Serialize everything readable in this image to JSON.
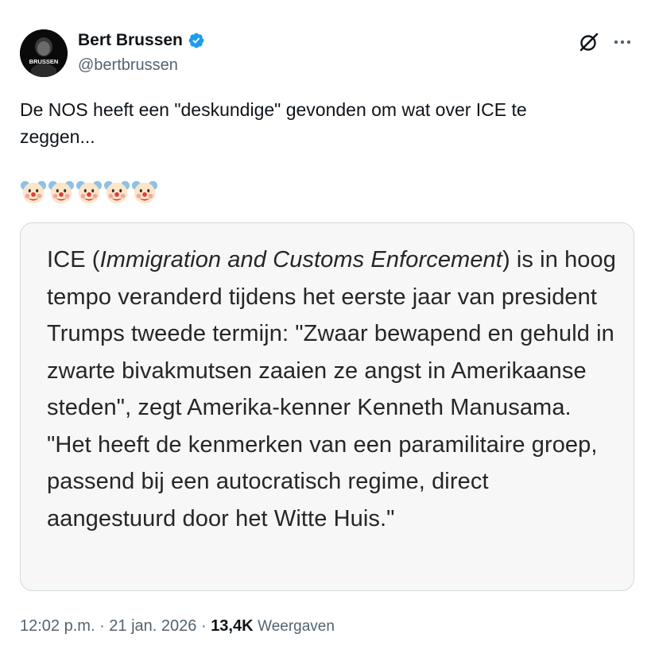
{
  "author": {
    "display_name": "Bert Brussen",
    "handle": "@bertbrussen",
    "avatar_text": "BRUSSEN",
    "verified": true
  },
  "tweet": {
    "text": "De NOS heeft een \"deskundige\" gevonden om wat over ICE te\nzeggen...",
    "emojis": [
      "clown-face",
      "clown-face",
      "clown-face",
      "clown-face",
      "clown-face"
    ]
  },
  "media": {
    "text_parts": {
      "before": "ICE (",
      "italic": "Immigration and Customs Enforcement",
      "after": ") is in hoog tempo veranderd tijdens het eerste jaar van president Trumps tweede termijn: \"Zwaar bewapend en gehuld in zwarte bivakmutsen zaaien ze angst in Amerikaanse steden\", zegt Amerika-kenner Kenneth Manusama. \"Het heeft de kenmerken van een paramilitaire groep, passend bij een autocratisch regime, direct aangestuurd door het Witte Huis.\""
    }
  },
  "meta": {
    "time": "12:02 p.m.",
    "separator1": " · ",
    "date": "21 jan. 2026",
    "separator2": " · ",
    "views_count": "13,4K",
    "views_label": "Weergaven"
  },
  "colors": {
    "verified_blue": "#1d9bf0",
    "secondary_text": "#536471",
    "primary_text": "#0f1419",
    "card_border": "#cfd9de"
  },
  "icons": {
    "grok": "grok-icon",
    "more": "more-options-icon",
    "verified": "verified-badge-icon"
  }
}
